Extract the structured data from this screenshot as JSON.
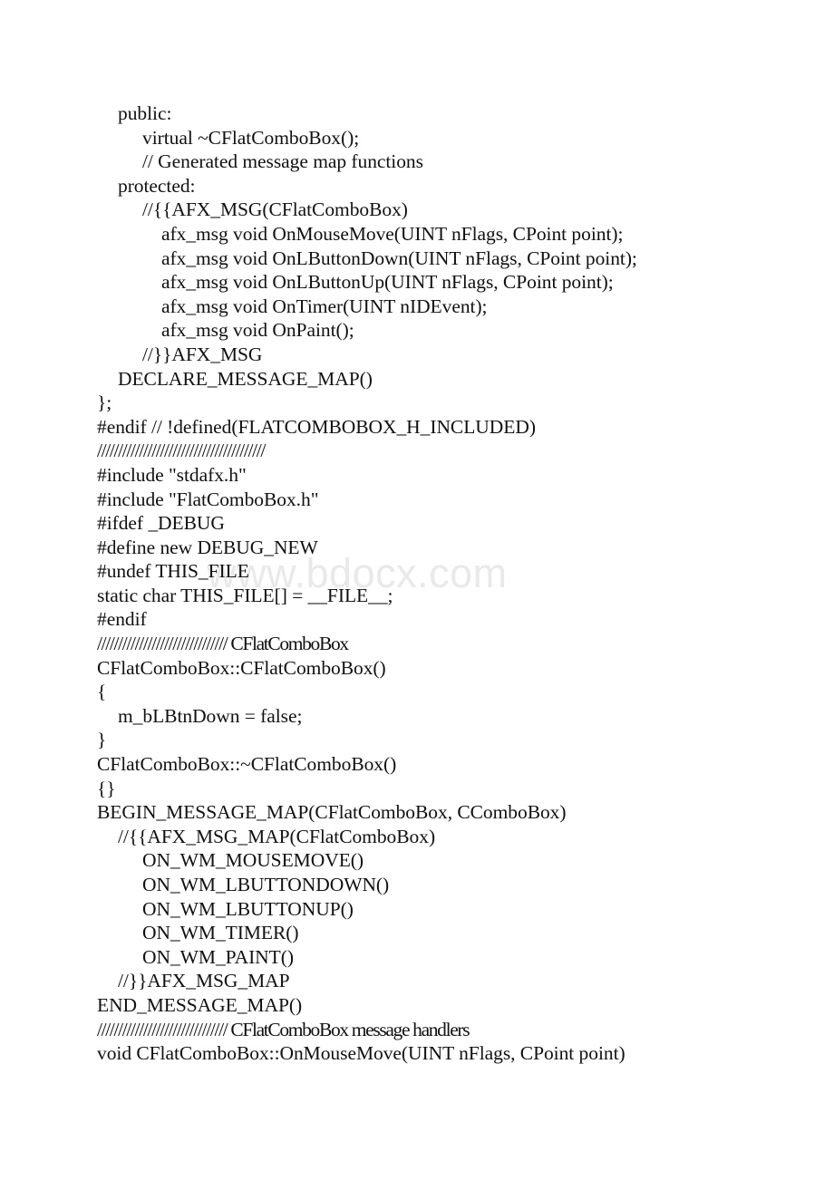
{
  "document": {
    "kind": "scanned-source-code-page",
    "watermark": "www.bdocx.com",
    "lines": [
      {
        "indent": 1,
        "text": "public:"
      },
      {
        "indent": 2,
        "text": "virtual ~CFlatComboBox();"
      },
      {
        "indent": 2,
        "text": "// Generated message map functions"
      },
      {
        "indent": 1,
        "text": "protected:"
      },
      {
        "indent": 2,
        "text": "//{{AFX_MSG(CFlatComboBox)"
      },
      {
        "indent": 3,
        "text": "afx_msg void OnMouseMove(UINT nFlags, CPoint point);"
      },
      {
        "indent": 3,
        "text": "afx_msg void OnLButtonDown(UINT nFlags, CPoint point);"
      },
      {
        "indent": 3,
        "text": "afx_msg void OnLButtonUp(UINT nFlags, CPoint point);"
      },
      {
        "indent": 3,
        "text": "afx_msg void OnTimer(UINT nIDEvent);"
      },
      {
        "indent": 3,
        "text": "afx_msg void OnPaint();"
      },
      {
        "indent": 2,
        "text": "//}}AFX_MSG"
      },
      {
        "indent": 1,
        "text": "DECLARE_MESSAGE_MAP()"
      },
      {
        "indent": 0,
        "text": "};"
      },
      {
        "indent": 0,
        "text": "#endif // !defined(FLATCOMBOBOX_H_INCLUDED)"
      },
      {
        "indent": 0,
        "text": "////////////////////////////////////////",
        "slashes": true
      },
      {
        "indent": 0,
        "text": "#include \"stdafx.h\""
      },
      {
        "indent": 0,
        "text": "#include \"FlatComboBox.h\""
      },
      {
        "indent": 0,
        "text": "#ifdef _DEBUG"
      },
      {
        "indent": 0,
        "text": "#define new DEBUG_NEW"
      },
      {
        "indent": 0,
        "text": "#undef THIS_FILE"
      },
      {
        "indent": 0,
        "text": "static char THIS_FILE[] = __FILE__;"
      },
      {
        "indent": 0,
        "text": "#endif"
      },
      {
        "indent": 0,
        "text": "/////////////////////////////// CFlatComboBox",
        "slashes": true
      },
      {
        "indent": 0,
        "text": "CFlatComboBox::CFlatComboBox()"
      },
      {
        "indent": 0,
        "text": "{"
      },
      {
        "indent": 1,
        "text": "m_bLBtnDown = false;"
      },
      {
        "indent": 0,
        "text": "}"
      },
      {
        "indent": 0,
        "text": "CFlatComboBox::~CFlatComboBox()"
      },
      {
        "indent": 0,
        "text": "{}"
      },
      {
        "indent": 0,
        "text": "BEGIN_MESSAGE_MAP(CFlatComboBox, CComboBox)"
      },
      {
        "indent": 1,
        "text": "//{{AFX_MSG_MAP(CFlatComboBox)"
      },
      {
        "indent": 2,
        "text": "ON_WM_MOUSEMOVE()"
      },
      {
        "indent": 2,
        "text": "ON_WM_LBUTTONDOWN()"
      },
      {
        "indent": 2,
        "text": "ON_WM_LBUTTONUP()"
      },
      {
        "indent": 2,
        "text": "ON_WM_TIMER()"
      },
      {
        "indent": 2,
        "text": "ON_WM_PAINT()"
      },
      {
        "indent": 1,
        "text": "//}}AFX_MSG_MAP"
      },
      {
        "indent": 0,
        "text": "END_MESSAGE_MAP()"
      },
      {
        "indent": 0,
        "text": "/////////////////////////////// CFlatComboBox message handlers",
        "slashes": true
      },
      {
        "indent": 0,
        "text": "void CFlatComboBox::OnMouseMove(UINT nFlags, CPoint point)"
      }
    ]
  }
}
